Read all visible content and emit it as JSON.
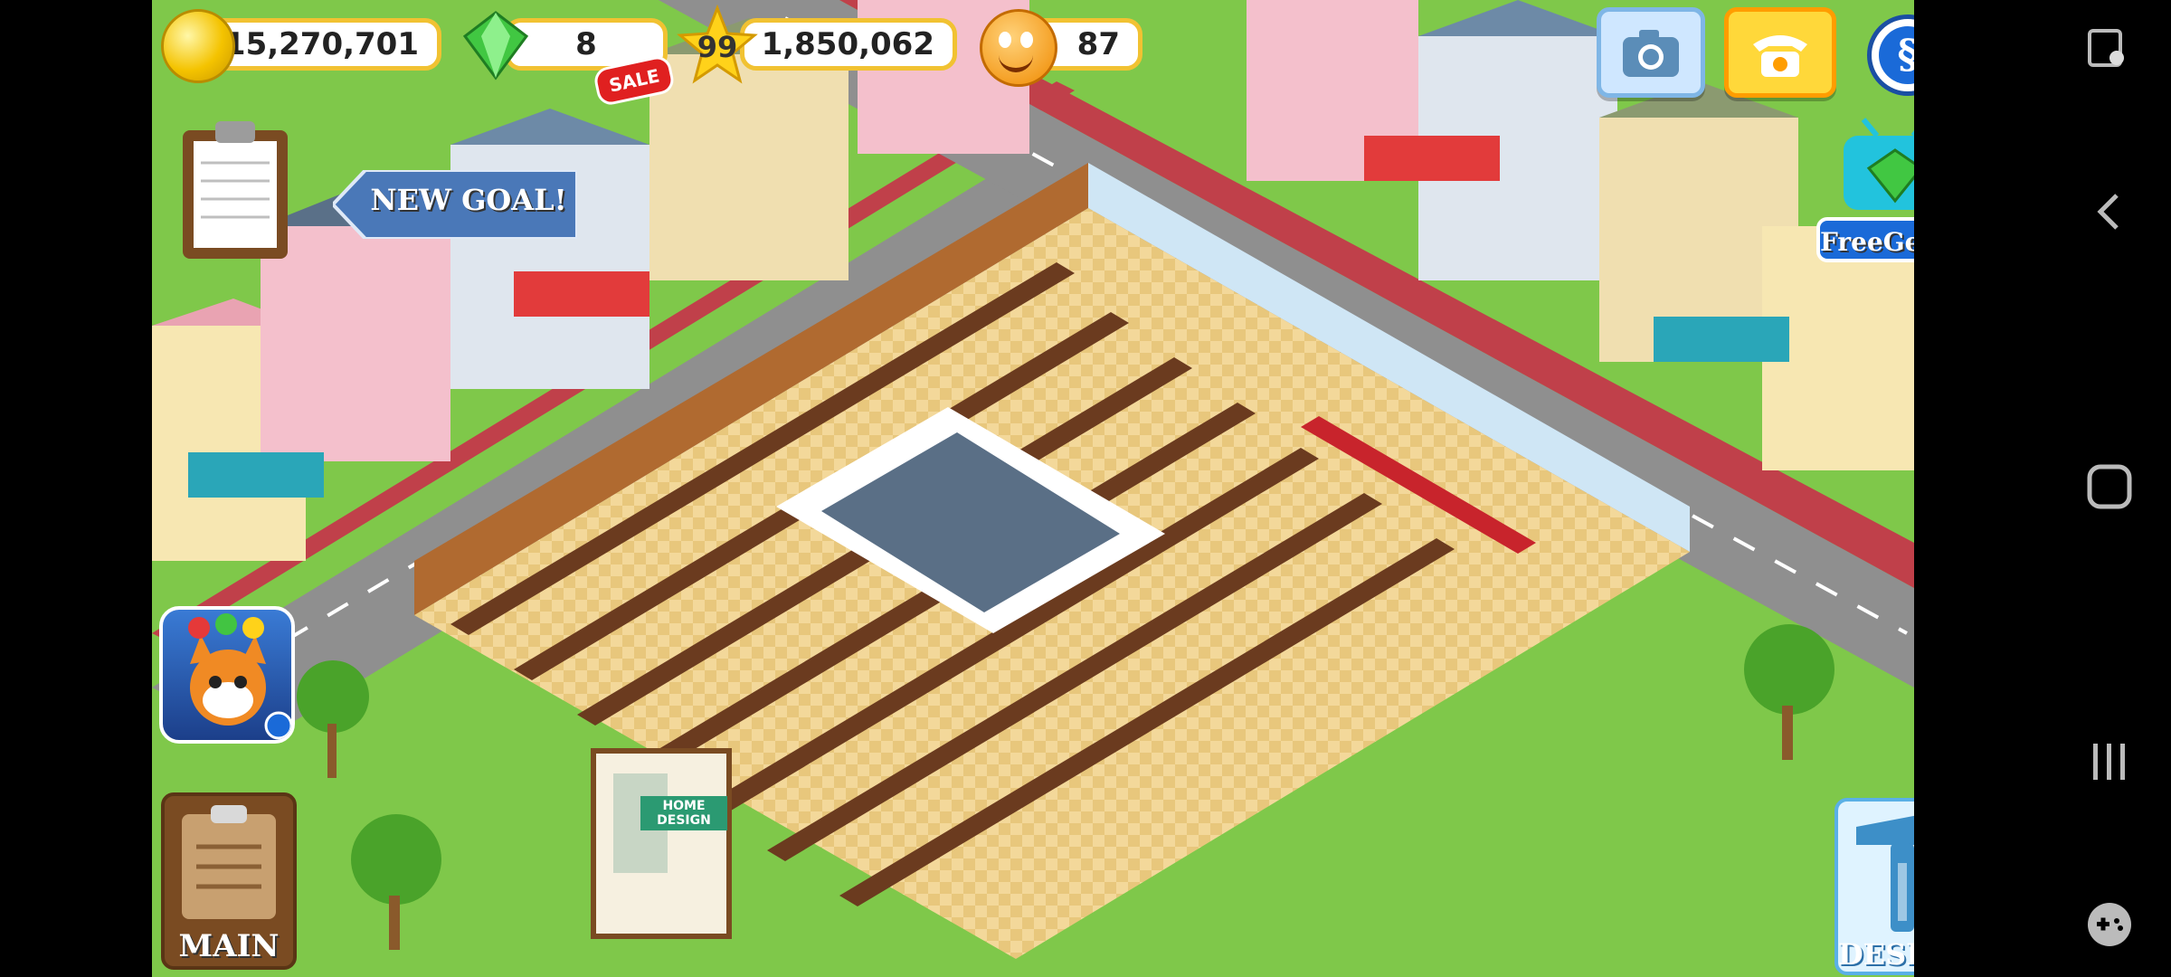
{
  "hud": {
    "coins": "15,270,701",
    "gems": "8",
    "sale_badge": "SALE",
    "level": "99",
    "experience": "1,850,062",
    "reputation": "87"
  },
  "goal_button": {
    "label": "NEW GOAL!"
  },
  "free_gems": {
    "label": "FreeGems"
  },
  "bottom_left": {
    "main_label": "MAIN"
  },
  "bottom_right": {
    "design_label": "DESIGN"
  },
  "billboard": {
    "text": "HOME DESIGN"
  },
  "colors": {
    "hud_border": "#f1c232",
    "grass": "#7fc84a",
    "road": "#8f8f8f",
    "sidewalk": "#c0404a",
    "floor": "#f3d89a"
  },
  "icons": [
    "coin-icon",
    "gem-icon",
    "star-icon",
    "smiley-icon",
    "camera-icon",
    "telephone-icon",
    "social-icon",
    "clipboard-icon",
    "tv-gem-icon",
    "game-app-icon",
    "hammer-icon",
    "system-back-icon",
    "system-home-icon",
    "system-recents-icon",
    "system-game-tools-icon",
    "screen-edit-icon"
  ]
}
